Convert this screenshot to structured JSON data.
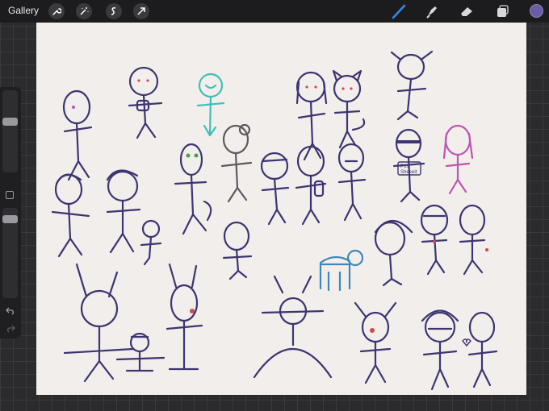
{
  "topbar": {
    "gallery_label": "Gallery",
    "left_tools": [
      "wrench-icon",
      "magic-wand-icon",
      "selection-icon",
      "transform-arrow-icon"
    ],
    "right_tools": [
      "brush-icon",
      "smudge-icon",
      "eraser-icon",
      "layers-icon"
    ],
    "active_color": "#6c5ba6"
  },
  "canvas": {
    "background": "#f2eeec",
    "figure_count": 29,
    "tshirt_text_line1": "Post",
    "tshirt_text_line2": "Sheeeit"
  },
  "sidebar": {
    "tools": [
      "brush-size-slider",
      "modify-button",
      "opacity-slider",
      "undo-icon",
      "redo-icon"
    ]
  },
  "colors": {
    "ink": "#3c3571",
    "teal": "#3fbfb8",
    "pink": "#c054b0",
    "blue": "#3d89b8"
  }
}
